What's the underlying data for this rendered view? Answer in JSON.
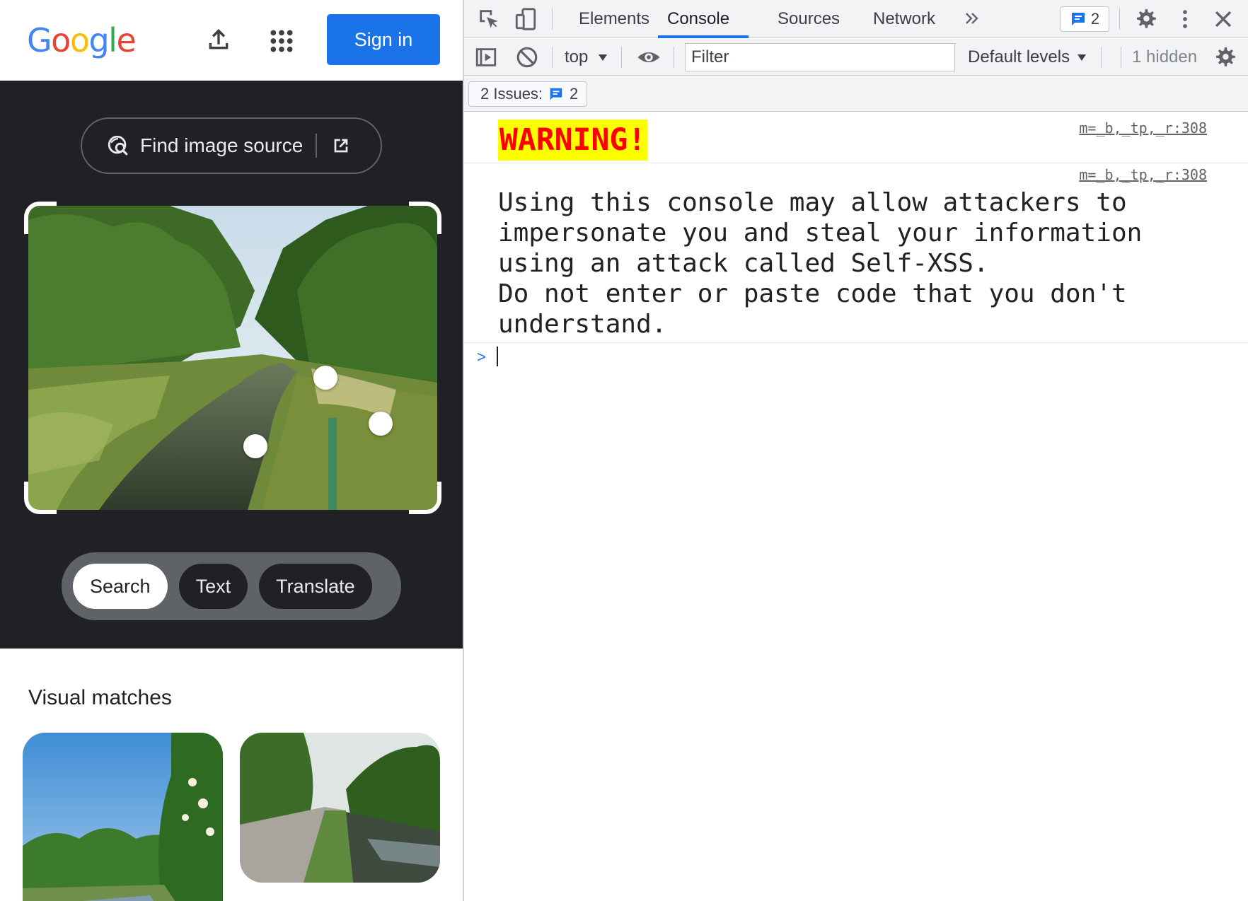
{
  "lens": {
    "logo_letters": [
      {
        "ch": "G",
        "color": "#4285f4"
      },
      {
        "ch": "o",
        "color": "#ea4335"
      },
      {
        "ch": "o",
        "color": "#fbbc05"
      },
      {
        "ch": "g",
        "color": "#4285f4"
      },
      {
        "ch": "l",
        "color": "#34a853"
      },
      {
        "ch": "e",
        "color": "#ea4335"
      }
    ],
    "header": {
      "upload_icon": "upload-icon",
      "apps_icon": "apps-grid-icon",
      "signin_label": "Sign in"
    },
    "find_source": {
      "label": "Find image source",
      "icon": "lens-search-icon",
      "open_icon": "open-in-new-icon"
    },
    "modes": [
      {
        "label": "Search",
        "active": true
      },
      {
        "label": "Text",
        "active": false
      },
      {
        "label": "Translate",
        "active": false
      }
    ],
    "visual_matches_title": "Visual matches"
  },
  "devtools": {
    "tabs": [
      "Elements",
      "Console",
      "Sources",
      "Network"
    ],
    "active_tab": "Console",
    "more_tabs_icon": "double-chevron-icon",
    "issues_count": "2",
    "toolbar": {
      "context": "top",
      "filter_placeholder": "Filter",
      "levels": "Default levels",
      "hidden": "1 hidden"
    },
    "issues_bar": {
      "label": "2 Issues:",
      "count": "2"
    },
    "messages": [
      {
        "text": "WARNING!",
        "source": "m=_b,_tp,_r:308"
      },
      {
        "text": "Using this console may allow attackers to\nimpersonate you and steal your information\nusing an attack called Self-XSS.\nDo not enter or paste code that you don't\nunderstand.",
        "source": "m=_b,_tp,_r:308"
      }
    ],
    "prompt_symbol": ">"
  }
}
